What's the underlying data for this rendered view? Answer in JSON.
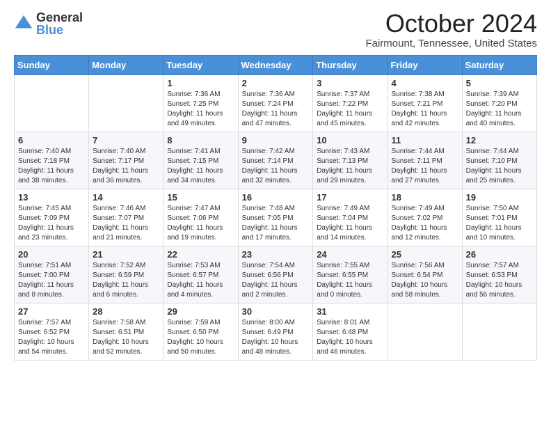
{
  "logo": {
    "general": "General",
    "blue": "Blue"
  },
  "title": "October 2024",
  "location": "Fairmount, Tennessee, United States",
  "days_of_week": [
    "Sunday",
    "Monday",
    "Tuesday",
    "Wednesday",
    "Thursday",
    "Friday",
    "Saturday"
  ],
  "weeks": [
    [
      {
        "day": "",
        "sunrise": "",
        "sunset": "",
        "daylight": ""
      },
      {
        "day": "",
        "sunrise": "",
        "sunset": "",
        "daylight": ""
      },
      {
        "day": "1",
        "sunrise": "Sunrise: 7:36 AM",
        "sunset": "Sunset: 7:25 PM",
        "daylight": "Daylight: 11 hours and 49 minutes."
      },
      {
        "day": "2",
        "sunrise": "Sunrise: 7:36 AM",
        "sunset": "Sunset: 7:24 PM",
        "daylight": "Daylight: 11 hours and 47 minutes."
      },
      {
        "day": "3",
        "sunrise": "Sunrise: 7:37 AM",
        "sunset": "Sunset: 7:22 PM",
        "daylight": "Daylight: 11 hours and 45 minutes."
      },
      {
        "day": "4",
        "sunrise": "Sunrise: 7:38 AM",
        "sunset": "Sunset: 7:21 PM",
        "daylight": "Daylight: 11 hours and 42 minutes."
      },
      {
        "day": "5",
        "sunrise": "Sunrise: 7:39 AM",
        "sunset": "Sunset: 7:20 PM",
        "daylight": "Daylight: 11 hours and 40 minutes."
      }
    ],
    [
      {
        "day": "6",
        "sunrise": "Sunrise: 7:40 AM",
        "sunset": "Sunset: 7:18 PM",
        "daylight": "Daylight: 11 hours and 38 minutes."
      },
      {
        "day": "7",
        "sunrise": "Sunrise: 7:40 AM",
        "sunset": "Sunset: 7:17 PM",
        "daylight": "Daylight: 11 hours and 36 minutes."
      },
      {
        "day": "8",
        "sunrise": "Sunrise: 7:41 AM",
        "sunset": "Sunset: 7:15 PM",
        "daylight": "Daylight: 11 hours and 34 minutes."
      },
      {
        "day": "9",
        "sunrise": "Sunrise: 7:42 AM",
        "sunset": "Sunset: 7:14 PM",
        "daylight": "Daylight: 11 hours and 32 minutes."
      },
      {
        "day": "10",
        "sunrise": "Sunrise: 7:43 AM",
        "sunset": "Sunset: 7:13 PM",
        "daylight": "Daylight: 11 hours and 29 minutes."
      },
      {
        "day": "11",
        "sunrise": "Sunrise: 7:44 AM",
        "sunset": "Sunset: 7:11 PM",
        "daylight": "Daylight: 11 hours and 27 minutes."
      },
      {
        "day": "12",
        "sunrise": "Sunrise: 7:44 AM",
        "sunset": "Sunset: 7:10 PM",
        "daylight": "Daylight: 11 hours and 25 minutes."
      }
    ],
    [
      {
        "day": "13",
        "sunrise": "Sunrise: 7:45 AM",
        "sunset": "Sunset: 7:09 PM",
        "daylight": "Daylight: 11 hours and 23 minutes."
      },
      {
        "day": "14",
        "sunrise": "Sunrise: 7:46 AM",
        "sunset": "Sunset: 7:07 PM",
        "daylight": "Daylight: 11 hours and 21 minutes."
      },
      {
        "day": "15",
        "sunrise": "Sunrise: 7:47 AM",
        "sunset": "Sunset: 7:06 PM",
        "daylight": "Daylight: 11 hours and 19 minutes."
      },
      {
        "day": "16",
        "sunrise": "Sunrise: 7:48 AM",
        "sunset": "Sunset: 7:05 PM",
        "daylight": "Daylight: 11 hours and 17 minutes."
      },
      {
        "day": "17",
        "sunrise": "Sunrise: 7:49 AM",
        "sunset": "Sunset: 7:04 PM",
        "daylight": "Daylight: 11 hours and 14 minutes."
      },
      {
        "day": "18",
        "sunrise": "Sunrise: 7:49 AM",
        "sunset": "Sunset: 7:02 PM",
        "daylight": "Daylight: 11 hours and 12 minutes."
      },
      {
        "day": "19",
        "sunrise": "Sunrise: 7:50 AM",
        "sunset": "Sunset: 7:01 PM",
        "daylight": "Daylight: 11 hours and 10 minutes."
      }
    ],
    [
      {
        "day": "20",
        "sunrise": "Sunrise: 7:51 AM",
        "sunset": "Sunset: 7:00 PM",
        "daylight": "Daylight: 11 hours and 8 minutes."
      },
      {
        "day": "21",
        "sunrise": "Sunrise: 7:52 AM",
        "sunset": "Sunset: 6:59 PM",
        "daylight": "Daylight: 11 hours and 6 minutes."
      },
      {
        "day": "22",
        "sunrise": "Sunrise: 7:53 AM",
        "sunset": "Sunset: 6:57 PM",
        "daylight": "Daylight: 11 hours and 4 minutes."
      },
      {
        "day": "23",
        "sunrise": "Sunrise: 7:54 AM",
        "sunset": "Sunset: 6:56 PM",
        "daylight": "Daylight: 11 hours and 2 minutes."
      },
      {
        "day": "24",
        "sunrise": "Sunrise: 7:55 AM",
        "sunset": "Sunset: 6:55 PM",
        "daylight": "Daylight: 11 hours and 0 minutes."
      },
      {
        "day": "25",
        "sunrise": "Sunrise: 7:56 AM",
        "sunset": "Sunset: 6:54 PM",
        "daylight": "Daylight: 10 hours and 58 minutes."
      },
      {
        "day": "26",
        "sunrise": "Sunrise: 7:57 AM",
        "sunset": "Sunset: 6:53 PM",
        "daylight": "Daylight: 10 hours and 56 minutes."
      }
    ],
    [
      {
        "day": "27",
        "sunrise": "Sunrise: 7:57 AM",
        "sunset": "Sunset: 6:52 PM",
        "daylight": "Daylight: 10 hours and 54 minutes."
      },
      {
        "day": "28",
        "sunrise": "Sunrise: 7:58 AM",
        "sunset": "Sunset: 6:51 PM",
        "daylight": "Daylight: 10 hours and 52 minutes."
      },
      {
        "day": "29",
        "sunrise": "Sunrise: 7:59 AM",
        "sunset": "Sunset: 6:50 PM",
        "daylight": "Daylight: 10 hours and 50 minutes."
      },
      {
        "day": "30",
        "sunrise": "Sunrise: 8:00 AM",
        "sunset": "Sunset: 6:49 PM",
        "daylight": "Daylight: 10 hours and 48 minutes."
      },
      {
        "day": "31",
        "sunrise": "Sunrise: 8:01 AM",
        "sunset": "Sunset: 6:48 PM",
        "daylight": "Daylight: 10 hours and 46 minutes."
      },
      {
        "day": "",
        "sunrise": "",
        "sunset": "",
        "daylight": ""
      },
      {
        "day": "",
        "sunrise": "",
        "sunset": "",
        "daylight": ""
      }
    ]
  ]
}
